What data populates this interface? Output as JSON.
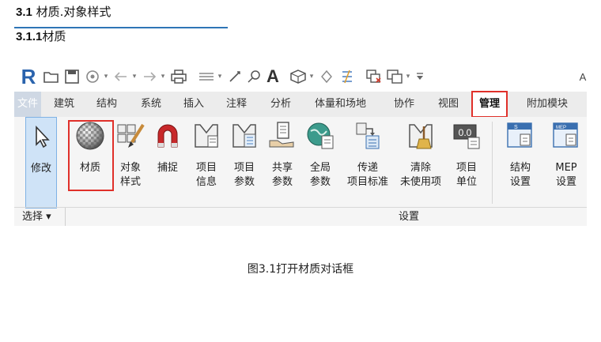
{
  "doc": {
    "heading_num": "3.1",
    "heading_text": " 材质.对象样式",
    "subheading_num": "3.1.1",
    "subheading_text": "材质",
    "caption": "图3.1打开材质对话框"
  },
  "qat": {
    "logo": "R",
    "dropdown": "▾",
    "overflow_label": "A"
  },
  "tabs": {
    "file": "文件",
    "architecture": "建筑",
    "structure": "结构",
    "systems": "系统",
    "insert": "插入",
    "annotate": "注释",
    "analyze": "分析",
    "massing": "体量和场地",
    "collaborate": "协作",
    "view": "视图",
    "manage": "管理",
    "addins": "附加模块"
  },
  "tools": {
    "modify": "修改",
    "materials": "材质",
    "object_styles_1": "对象",
    "object_styles_2": "样式",
    "snaps": "捕捉",
    "project_info_1": "项目",
    "project_info_2": "信息",
    "project_params_1": "项目",
    "project_params_2": "参数",
    "shared_params_1": "共享",
    "shared_params_2": "参数",
    "global_params_1": "全局",
    "global_params_2": "参数",
    "transfer_1": "传递",
    "transfer_2": "项目标准",
    "purge_1": "清除",
    "purge_2": "未使用项",
    "units_1": "项目",
    "units_2": "单位",
    "struct_settings_1": "结构",
    "struct_settings_2": "设置",
    "mep_settings_1": "MEP",
    "mep_settings_2": "设置",
    "units_icon_text": "0.0",
    "mep_icon_text": "MEP"
  },
  "footer": {
    "select": "选择 ▾",
    "settings": "设置"
  }
}
